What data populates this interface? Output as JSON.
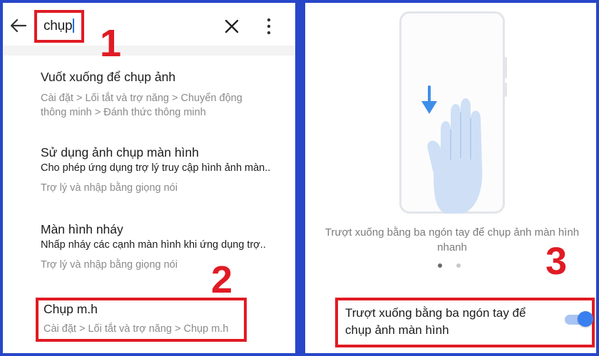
{
  "search": {
    "query": "chụp",
    "icons": {
      "back": "arrow-left-icon",
      "clear": "close-icon",
      "more": "more-vertical-icon"
    }
  },
  "steps": [
    "1",
    "2",
    "3"
  ],
  "results": [
    {
      "title": "Vuốt xuống để chụp ảnh",
      "path": "Cài đặt > Lối tắt và trợ năng > Chuyển động thông minh > Đánh thức thông minh"
    },
    {
      "title": "Sử dụng ảnh chụp màn hình",
      "description": "Cho phép ứng dụng trợ lý truy cập hình ảnh màn..",
      "path": "Trợ lý và nhập bằng giọng nói"
    },
    {
      "title": "Màn hình nháy",
      "description": "Nhấp nháy các cạnh màn hình khi ứng dụng trợ..",
      "path": "Trợ lý và nhập bằng giọng nói"
    },
    {
      "title": "Chụp m.h",
      "path": "Cài đặt > Lối tắt và trợ năng > Chụp m.h"
    }
  ],
  "gesture": {
    "caption": "Trượt xuống bằng ba ngón tay để chụp ảnh màn hình nhanh",
    "page_count": 2,
    "active_page": 1
  },
  "setting": {
    "label": "Trượt xuống bằng ba ngón tay để chụp ảnh màn hình",
    "enabled": true
  },
  "colors": {
    "highlight": "#e01b24",
    "accent": "#3a7ff0",
    "frame": "#2747c8"
  }
}
